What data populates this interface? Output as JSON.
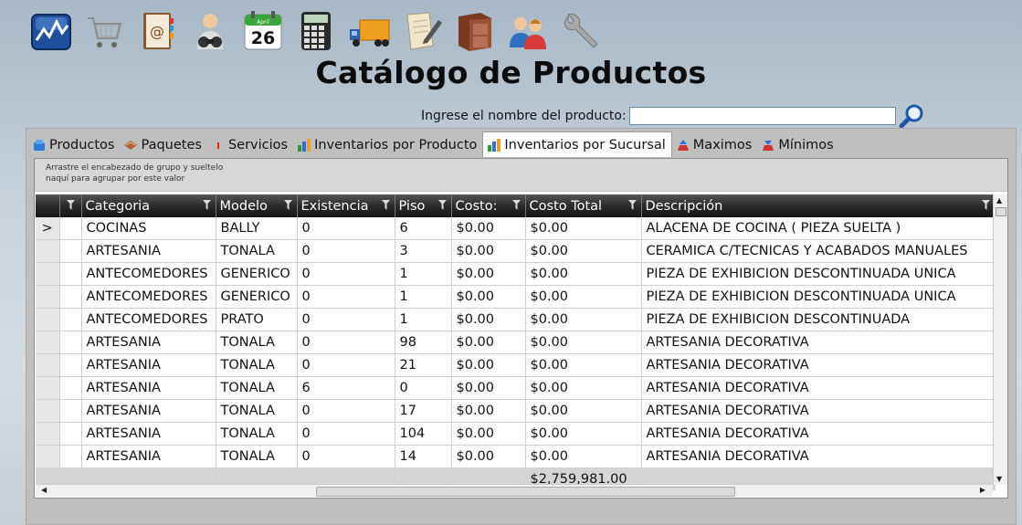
{
  "toolbar": {
    "items": [
      {
        "name": "sales-chart-icon"
      },
      {
        "name": "shopping-cart-icon"
      },
      {
        "name": "address-book-icon"
      },
      {
        "name": "binoculars-person-icon"
      },
      {
        "name": "calendar-icon",
        "day": "26",
        "month": "April"
      },
      {
        "name": "calculator-icon"
      },
      {
        "name": "delivery-truck-icon"
      },
      {
        "name": "document-edit-icon"
      },
      {
        "name": "furniture-cabinet-icon"
      },
      {
        "name": "users-icon"
      },
      {
        "name": "wrench-settings-icon"
      }
    ]
  },
  "page": {
    "title": "Catálogo de Productos"
  },
  "search": {
    "label": "Ingrese el nombre del producto:",
    "value": "",
    "placeholder": ""
  },
  "tabs": [
    {
      "label": "Productos",
      "icon": "product-icon"
    },
    {
      "label": "Paquetes",
      "icon": "package-icon"
    },
    {
      "label": "Servicios",
      "icon": "service-icon"
    },
    {
      "label": "Inventarios por Producto",
      "icon": "bar-chart-icon"
    },
    {
      "label": "Inventarios por Sucursal",
      "icon": "bar-chart-icon",
      "active": true
    },
    {
      "label": "Maximos",
      "icon": "max-icon"
    },
    {
      "label": "Mínimos",
      "icon": "min-icon"
    }
  ],
  "grid": {
    "group_panel_text": "Arrastre el encabezado de grupo y sueltelo\nnaquí para agrupar por este valor",
    "columns": [
      "Categoria",
      "Modelo",
      "Existencia",
      "Piso",
      "Costo:",
      "Costo Total",
      "Descripción"
    ],
    "rows": [
      [
        "COCINAS",
        "BALLY",
        "0",
        "6",
        "$0.00",
        "$0.00",
        "ALACENA DE COCINA  ( PIEZA SUELTA )"
      ],
      [
        "ARTESANIA",
        "TONALA",
        "0",
        "3",
        "$0.00",
        "$0.00",
        "CERAMICA C/TECNICAS Y ACABADOS MANUALES"
      ],
      [
        "ANTECOMEDORES",
        "GENERICO",
        "0",
        "1",
        "$0.00",
        "$0.00",
        "PIEZA DE EXHIBICION DESCONTINUADA UNICA"
      ],
      [
        "ANTECOMEDORES",
        "GENERICO",
        "0",
        "1",
        "$0.00",
        "$0.00",
        "PIEZA DE EXHIBICION DESCONTINUADA UNICA"
      ],
      [
        "ANTECOMEDORES",
        "PRATO",
        "0",
        "1",
        "$0.00",
        "$0.00",
        "PIEZA DE EXHIBICION DESCONTINUADA"
      ],
      [
        "ARTESANIA",
        "TONALA",
        "0",
        "98",
        "$0.00",
        "$0.00",
        "ARTESANIA DECORATIVA"
      ],
      [
        "ARTESANIA",
        "TONALA",
        "0",
        "21",
        "$0.00",
        "$0.00",
        "ARTESANIA DECORATIVA"
      ],
      [
        "ARTESANIA",
        "TONALA",
        "6",
        "0",
        "$0.00",
        "$0.00",
        "ARTESANIA DECORATIVA"
      ],
      [
        "ARTESANIA",
        "TONALA",
        "0",
        "17",
        "$0.00",
        "$0.00",
        "ARTESANIA DECORATIVA"
      ],
      [
        "ARTESANIA",
        "TONALA",
        "0",
        "104",
        "$0.00",
        "$0.00",
        "ARTESANIA DECORATIVA"
      ],
      [
        "ARTESANIA",
        "TONALA",
        "0",
        "14",
        "$0.00",
        "$0.00",
        "ARTESANIA DECORATIVA"
      ]
    ],
    "current_row_marker": ">",
    "footer": {
      "costo_total_sum": "$2,759,981.00"
    }
  }
}
